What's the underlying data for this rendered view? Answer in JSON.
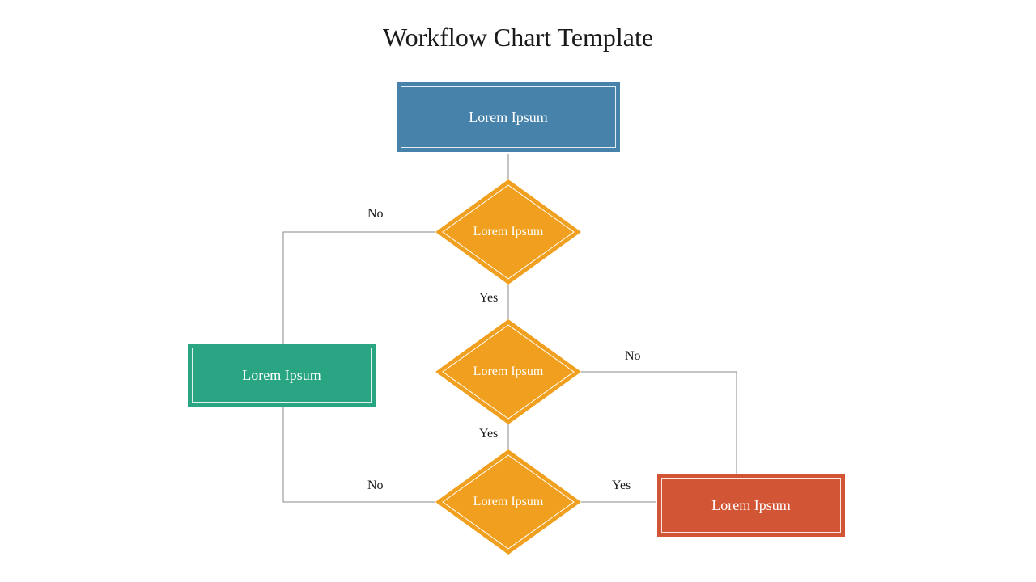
{
  "title": "Workflow Chart Template",
  "colors": {
    "blue": "#4682a9",
    "orange": "#f0a01e",
    "green": "#2aa583",
    "red": "#d25635",
    "line": "#888888"
  },
  "nodes": {
    "start": {
      "label": "Lorem Ipsum"
    },
    "d1": {
      "label": "Lorem Ipsum"
    },
    "d2": {
      "label": "Lorem Ipsum"
    },
    "d3": {
      "label": "Lorem Ipsum"
    },
    "left": {
      "label": "Lorem Ipsum"
    },
    "right": {
      "label": "Lorem Ipsum"
    }
  },
  "edge_labels": {
    "d1_no": "No",
    "d1_yes": "Yes",
    "d2_no": "No",
    "d2_yes": "Yes",
    "d3_no": "No",
    "d3_yes": "Yes"
  },
  "chart_data": {
    "type": "flowchart",
    "title": "Workflow Chart Template",
    "nodes": [
      {
        "id": "start",
        "shape": "rect",
        "label": "Lorem Ipsum",
        "color": "#4682a9"
      },
      {
        "id": "d1",
        "shape": "diamond",
        "label": "Lorem Ipsum",
        "color": "#f0a01e"
      },
      {
        "id": "d2",
        "shape": "diamond",
        "label": "Lorem Ipsum",
        "color": "#f0a01e"
      },
      {
        "id": "d3",
        "shape": "diamond",
        "label": "Lorem Ipsum",
        "color": "#f0a01e"
      },
      {
        "id": "left",
        "shape": "rect",
        "label": "Lorem Ipsum",
        "color": "#2aa583"
      },
      {
        "id": "right",
        "shape": "rect",
        "label": "Lorem Ipsum",
        "color": "#d25635"
      }
    ],
    "edges": [
      {
        "from": "start",
        "to": "d1",
        "label": ""
      },
      {
        "from": "d1",
        "to": "left",
        "label": "No"
      },
      {
        "from": "d1",
        "to": "d2",
        "label": "Yes"
      },
      {
        "from": "d2",
        "to": "right",
        "label": "No"
      },
      {
        "from": "d2",
        "to": "d3",
        "label": "Yes"
      },
      {
        "from": "d3",
        "to": "left",
        "label": "No"
      },
      {
        "from": "d3",
        "to": "right",
        "label": "Yes"
      }
    ]
  }
}
